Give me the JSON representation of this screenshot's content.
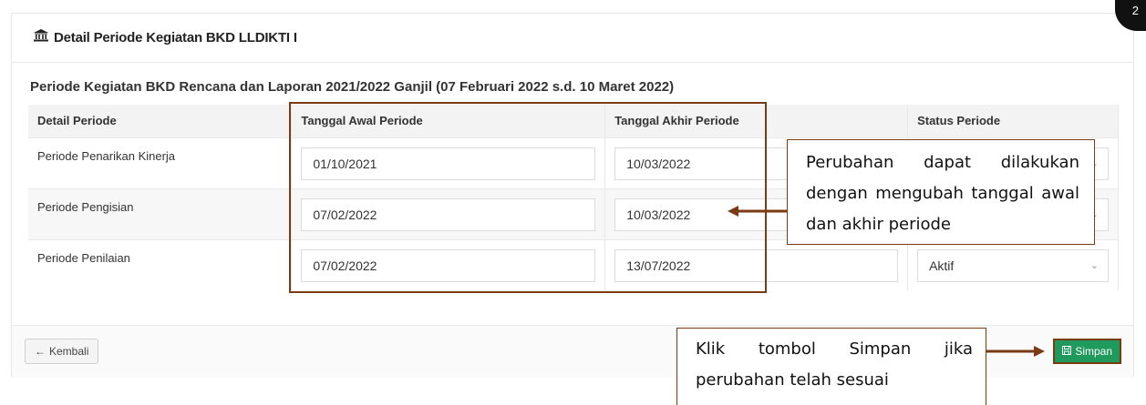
{
  "header": {
    "title": "Detail Periode Kegiatan BKD LLDIKTI I"
  },
  "section_title": "Periode Kegiatan BKD Rencana dan Laporan 2021/2022 Ganjil (07 Februari 2022 s.d. 10 Maret 2022)",
  "table": {
    "columns": [
      "Detail Periode",
      "Tanggal Awal Periode",
      "Tanggal Akhir Periode",
      "Status Periode"
    ],
    "rows": [
      {
        "label": "Periode Penarikan Kinerja",
        "start": "01/10/2021",
        "end": "10/03/2022",
        "status": ""
      },
      {
        "label": "Periode Pengisian",
        "start": "07/02/2022",
        "end": "10/03/2022",
        "status": ""
      },
      {
        "label": "Periode Penilaian",
        "start": "07/02/2022",
        "end": "13/07/2022",
        "status": "Aktif"
      }
    ]
  },
  "footer": {
    "back_label": "Kembali",
    "save_label": "Simpan"
  },
  "callouts": {
    "edit_hint": "Perubahan dapat dilakukan dengan mengubah tanggal awal dan akhir periode",
    "save_hint": "Klik tombol Simpan jika perubahan telah sesuai"
  },
  "badge": "2",
  "icons": {
    "header": "bank-icon",
    "back": "arrow-left-icon",
    "save": "floppy-disk-icon",
    "dropdown": "chevron-down-icon"
  },
  "colors": {
    "annotation": "#7a3b12",
    "save_button": "#1f9a5c"
  }
}
